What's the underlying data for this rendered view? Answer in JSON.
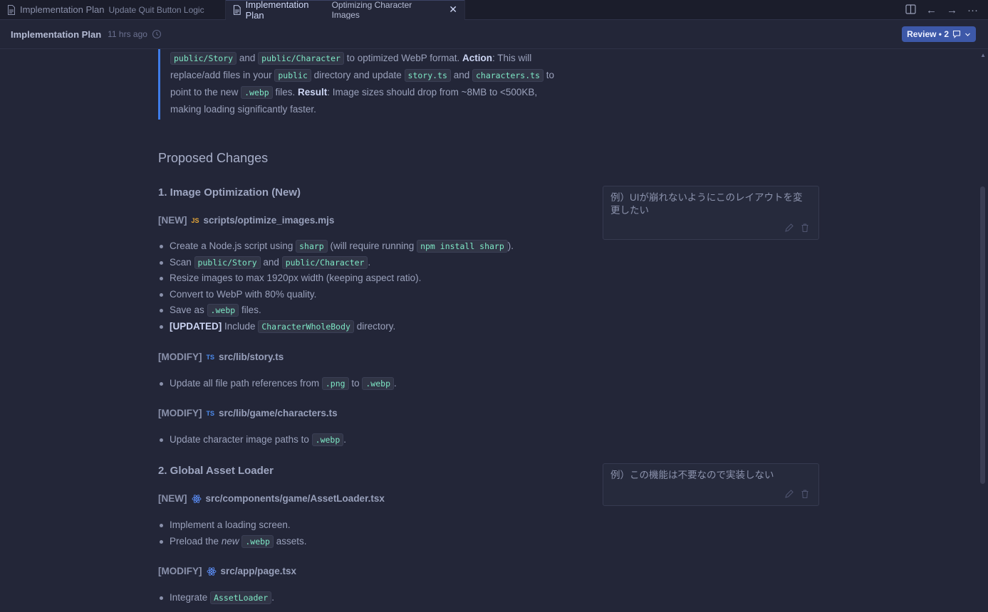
{
  "tabs": [
    {
      "title": "Implementation Plan",
      "subtitle": "Update Quit Button Logic",
      "active": false
    },
    {
      "title": "Implementation Plan",
      "subtitle": "Optimizing Character Images",
      "active": true
    }
  ],
  "tab_actions": {
    "split": "split-editor-icon",
    "back": "←",
    "forward": "→",
    "more": "···"
  },
  "header": {
    "title": "Implementation Plan",
    "time": "11 hrs ago"
  },
  "review": {
    "label": "Review • 2",
    "icon": "comment-icon"
  },
  "quote": {
    "code_story": "public/Story",
    "and1": "and",
    "code_character": "public/Character",
    "text1": "to optimized WebP format.",
    "action_label": "Action",
    "text2": ": This will",
    "text3": "replace/add files in your",
    "code_public": "public",
    "text4": "directory and update",
    "code_storyts": "story.ts",
    "and2": "and",
    "code_charactersts": "characters.ts",
    "to": "to",
    "text5": "point to the new",
    "code_webp": ".webp",
    "text6": "files.",
    "result_label": "Result",
    "text7": ": Image sizes should drop from ~8MB to <500KB,",
    "text8": "making loading significantly faster."
  },
  "sections": {
    "proposed_changes": "Proposed Changes",
    "s1_title": "1. Image Optimization (New)",
    "s2_title": "2. Global Asset Loader"
  },
  "files": {
    "f1": {
      "tag": "[NEW]",
      "badge": "JS",
      "path": "scripts/optimize_images.mjs"
    },
    "f2": {
      "tag": "[MODIFY]",
      "badge": "TS",
      "path": "src/lib/story.ts"
    },
    "f3": {
      "tag": "[MODIFY]",
      "badge": "TS",
      "path": "src/lib/game/characters.ts"
    },
    "f4": {
      "tag": "[NEW]",
      "path": "src/components/game/AssetLoader.tsx"
    },
    "f5": {
      "tag": "[MODIFY]",
      "path": "src/app/page.tsx"
    }
  },
  "list1": {
    "i1a": "Create a Node.js script using",
    "i1code1": "sharp",
    "i1b": "(will require running",
    "i1code2": "npm install sharp",
    "i1c": ").",
    "i2a": "Scan",
    "i2code1": "public/Story",
    "i2b": "and",
    "i2code2": "public/Character",
    "i2c": ".",
    "i3": "Resize images to max 1920px width (keeping aspect ratio).",
    "i4": "Convert to WebP with 80% quality.",
    "i5a": "Save as",
    "i5code": ".webp",
    "i5b": "files.",
    "i6bold": "[UPDATED]",
    "i6a": "Include",
    "i6code": "CharacterWholeBody",
    "i6b": "directory."
  },
  "list2": {
    "a": "Update all file path references from",
    "code1": ".png",
    "b": "to",
    "code2": ".webp",
    "c": "."
  },
  "list3": {
    "a": "Update character image paths to",
    "code": ".webp",
    "b": "."
  },
  "list4": {
    "i1": "Implement a loading screen.",
    "i2a": "Preload the",
    "i2em": "new",
    "i2code": ".webp",
    "i2b": "assets."
  },
  "list5": {
    "a": "Integrate",
    "code": "AssetLoader",
    "b": "."
  },
  "comments": [
    {
      "text": "例）UIが崩れないようにこのレイアウトを変更したい"
    },
    {
      "text": "例）この機能は不要なので実装しない"
    }
  ]
}
